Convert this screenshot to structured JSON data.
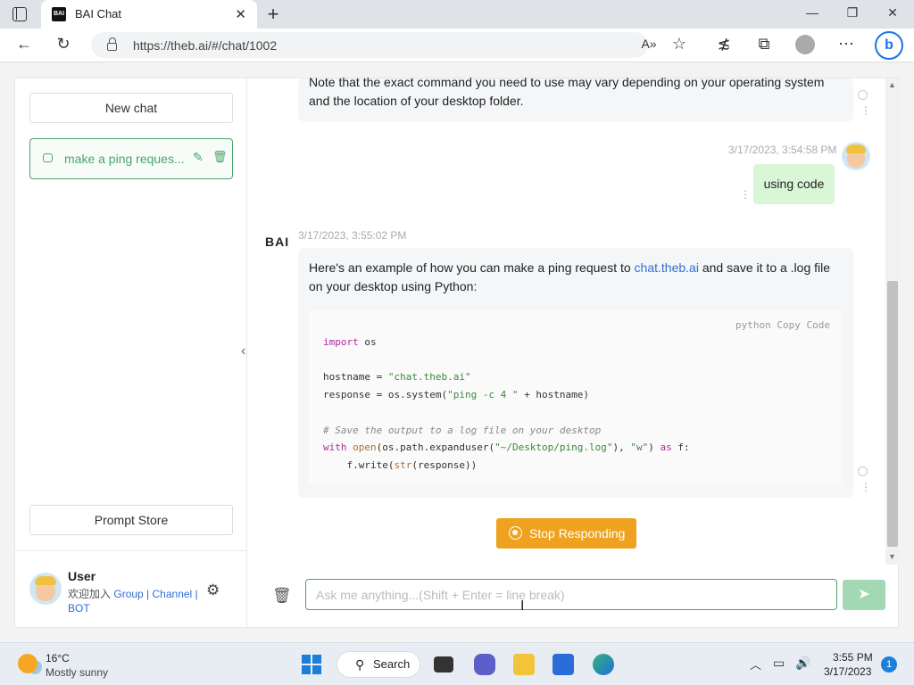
{
  "browser": {
    "tab_title": "BAI Chat",
    "tab_favicon_text": "BAI",
    "url": "https://theb.ai/#/chat/1002"
  },
  "sidebar": {
    "new_chat_label": "New chat",
    "chat_item_label": "make a ping reques...",
    "prompt_store_label": "Prompt Store",
    "user": {
      "name": "User",
      "join_text": "欢迎加入",
      "group_link": "Group",
      "sep1": " | ",
      "channel_link": "Channel",
      "sep2": " | ",
      "bot_link": "BOT"
    }
  },
  "chat": {
    "top_message": "Note that the exact command you need to use may vary depending on your operating system and the location of your desktop folder.",
    "user_timestamp": "3/17/2023, 3:54:58 PM",
    "user_message": "using code",
    "bot_logo": "BAI",
    "bot_timestamp": "3/17/2023, 3:55:02 PM",
    "bot_message_before": "Here's an example of how you can make a ping request to ",
    "bot_message_link": "chat.theb.ai",
    "bot_message_after": " and save it to a .log file on your desktop using Python:",
    "code_header": "python  Copy  Code",
    "stop_button_label": "Stop Responding",
    "input_placeholder": "Ask me anything...(Shift + Enter = line break)"
  },
  "taskbar": {
    "temperature": "16°C",
    "weather": "Mostly sunny",
    "search_label": "Search",
    "time": "3:55 PM",
    "date": "3/17/2023",
    "notification_count": "1"
  },
  "colors": {
    "accent_green": "#4aa36d",
    "stop_orange": "#efa21f",
    "link_blue": "#2f6fd6"
  }
}
